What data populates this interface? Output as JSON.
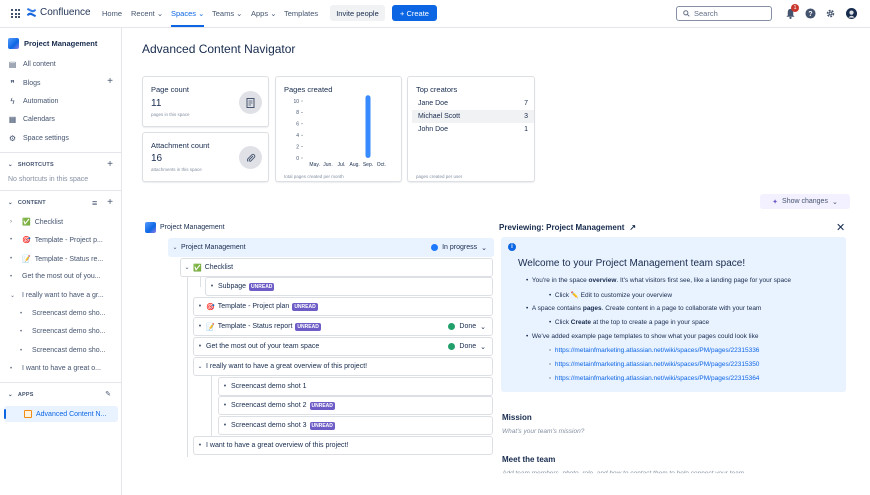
{
  "topnav": {
    "app_name": "Confluence",
    "items": [
      "Home",
      "Recent",
      "Spaces",
      "Teams",
      "Apps",
      "Templates"
    ],
    "invite_label": "Invite people",
    "create_label": "+ Create",
    "search_placeholder": "Search",
    "notification_count": "1",
    "accent": "#0c66e4"
  },
  "sidebar": {
    "space_name": "Project Management",
    "items": [
      {
        "icon": "content-icon",
        "label": "All content"
      },
      {
        "icon": "blog-icon",
        "label": "Blogs"
      },
      {
        "icon": "automation-icon",
        "label": "Automation"
      },
      {
        "icon": "calendar-icon",
        "label": "Calendars"
      },
      {
        "icon": "gear-icon",
        "label": "Space settings"
      }
    ],
    "shortcuts_label": "SHORTCUTS",
    "shortcuts_empty": "No shortcuts in this space",
    "content_label": "CONTENT",
    "content_tree": [
      "Checklist",
      "Template - Project p...",
      "Template - Status re...",
      "Get the most out of you...",
      "I really want to have a gr...",
      "Screencast demo sho...",
      "Screencast demo sho...",
      "Screencast demo sho...",
      "I want to have a great o..."
    ],
    "apps_label": "APPS",
    "app_item": "Advanced Content N..."
  },
  "main": {
    "title": "Advanced Content Navigator",
    "page_count": {
      "title": "Page count",
      "value": "11",
      "sub": "pages in this space"
    },
    "attachment_count": {
      "title": "Attachment count",
      "value": "16",
      "sub": "attachments in this space"
    },
    "pages_created": {
      "title": "Pages created",
      "sub": "total pages created per month"
    },
    "top_creators": {
      "title": "Top creators",
      "rows": [
        {
          "name": "Jane Doe",
          "count": "7"
        },
        {
          "name": "Michael Scott",
          "count": "3"
        },
        {
          "name": "John Doe",
          "count": "1"
        }
      ],
      "sub": "pages created per user"
    },
    "show_changes_label": "Show changes"
  },
  "chart_data": {
    "type": "bar",
    "title": "Pages created",
    "categories": [
      "May.",
      "Jun.",
      "Jul.",
      "Aug.",
      "Sep.",
      "Oct."
    ],
    "values": [
      0,
      0,
      0,
      0,
      11,
      0
    ],
    "yticks": [
      "10",
      "8",
      "6",
      "4",
      "2",
      "0"
    ],
    "ylim": [
      0,
      11
    ],
    "bar_color": "#388bff"
  },
  "tree": {
    "root": "Project Management",
    "nodes": [
      {
        "label": "Project Management",
        "status": "In progress",
        "status_color": "#1d7afc"
      },
      {
        "label": "Checklist"
      },
      {
        "label": "Subpage",
        "badge": "UNREAD"
      },
      {
        "label": "Template - Project plan",
        "badge": "UNREAD"
      },
      {
        "label": "Template - Status report",
        "badge": "UNREAD",
        "status": "Done",
        "status_color": "#22a06b"
      },
      {
        "label": "Get the most out of your team space",
        "status": "Done",
        "status_color": "#22a06b"
      },
      {
        "label": "I really want to have a great overview of this project!"
      },
      {
        "label": "Screencast demo shot 1"
      },
      {
        "label": "Screencast demo shot 2",
        "badge": "UNREAD"
      },
      {
        "label": "Screencast demo shot 3",
        "badge": "UNREAD"
      },
      {
        "label": "I want to have a great overview of this project!"
      }
    ]
  },
  "preview": {
    "heading": "Previewing: Project Management",
    "welcome": "Welcome to your Project Management team space!",
    "b1_pre": "You're in the space ",
    "b1_bold": "overview",
    "b1_post": ". It's what visitors first see, like a landing page for your space",
    "b1_sub": "Click ✏️ Edit to customize your overview",
    "b2_pre": "A space contains ",
    "b2_bold": "pages",
    "b2_post": ". Create content in a page to collaborate with your team",
    "b2_sub_pre": "Click ",
    "b2_sub_bold": "Create",
    "b2_sub_post": " at the top to create a page in your space",
    "b3": "We've added example page templates to show what your pages could look like",
    "links": [
      "https://metainfmarketing.atlassian.net/wiki/spaces/PM/pages/22315336",
      "https://metainfmarketing.atlassian.net/wiki/spaces/PM/pages/22315350",
      "https://metainfmarketing.atlassian.net/wiki/spaces/PM/pages/22315364"
    ],
    "mission_h": "Mission",
    "mission_p": "What's your team's mission?",
    "team_h": "Meet the team",
    "team_p": "Add team members, photo, role, and how to contact them to help connect your team"
  }
}
